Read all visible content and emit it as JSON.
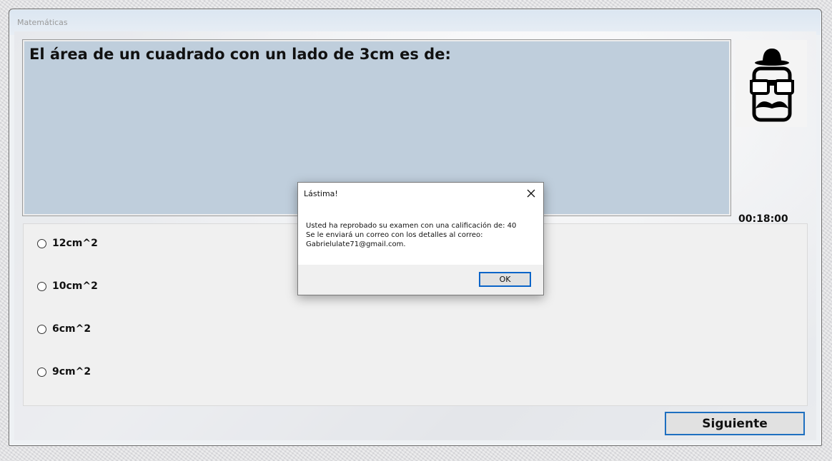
{
  "window": {
    "title": "Matemáticas"
  },
  "question": {
    "text": "El área de un cuadrado con un lado de 3cm es de:"
  },
  "timer": {
    "value": "00:18:00"
  },
  "options": [
    {
      "label": "12cm^2"
    },
    {
      "label": "10cm^2"
    },
    {
      "label": "6cm^2"
    },
    {
      "label": "9cm^2"
    }
  ],
  "buttons": {
    "next_label": "Siguiente"
  },
  "dialog": {
    "title": "Lástima!",
    "line1": "Usted ha reprobado su examen con una calificación de: 40",
    "line2": "Se le enviará un correo con los detalles al correo:",
    "line3": "Gabrielulate71@gmail.com.",
    "ok_label": "OK"
  },
  "icons": {
    "avatar": "hat-glasses-mustache-icon",
    "close": "close-icon"
  }
}
